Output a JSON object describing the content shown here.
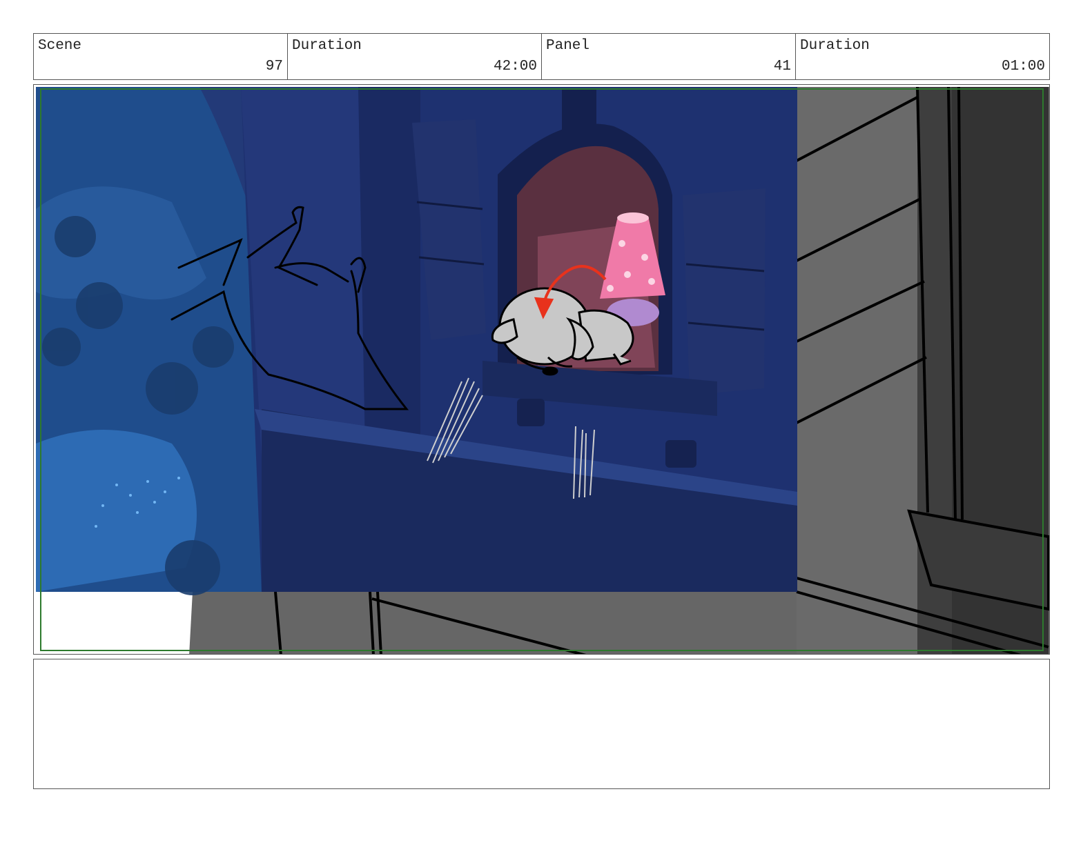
{
  "header": {
    "scene_label": "Scene",
    "scene_value": "97",
    "duration1_label": "Duration",
    "duration1_value": "42:00",
    "panel_label": "Panel",
    "panel_value": "41",
    "duration2_label": "Duration",
    "duration2_value": "01:00"
  },
  "notes": {
    "text": ""
  },
  "colors": {
    "night_blue": "#233a78",
    "deep_blue": "#1a2a5e",
    "lamp_pink": "#f07aa8",
    "action_arrow": "#e8321c",
    "safe_frame": "#2d7a2d",
    "grey_fill": "#666666"
  }
}
